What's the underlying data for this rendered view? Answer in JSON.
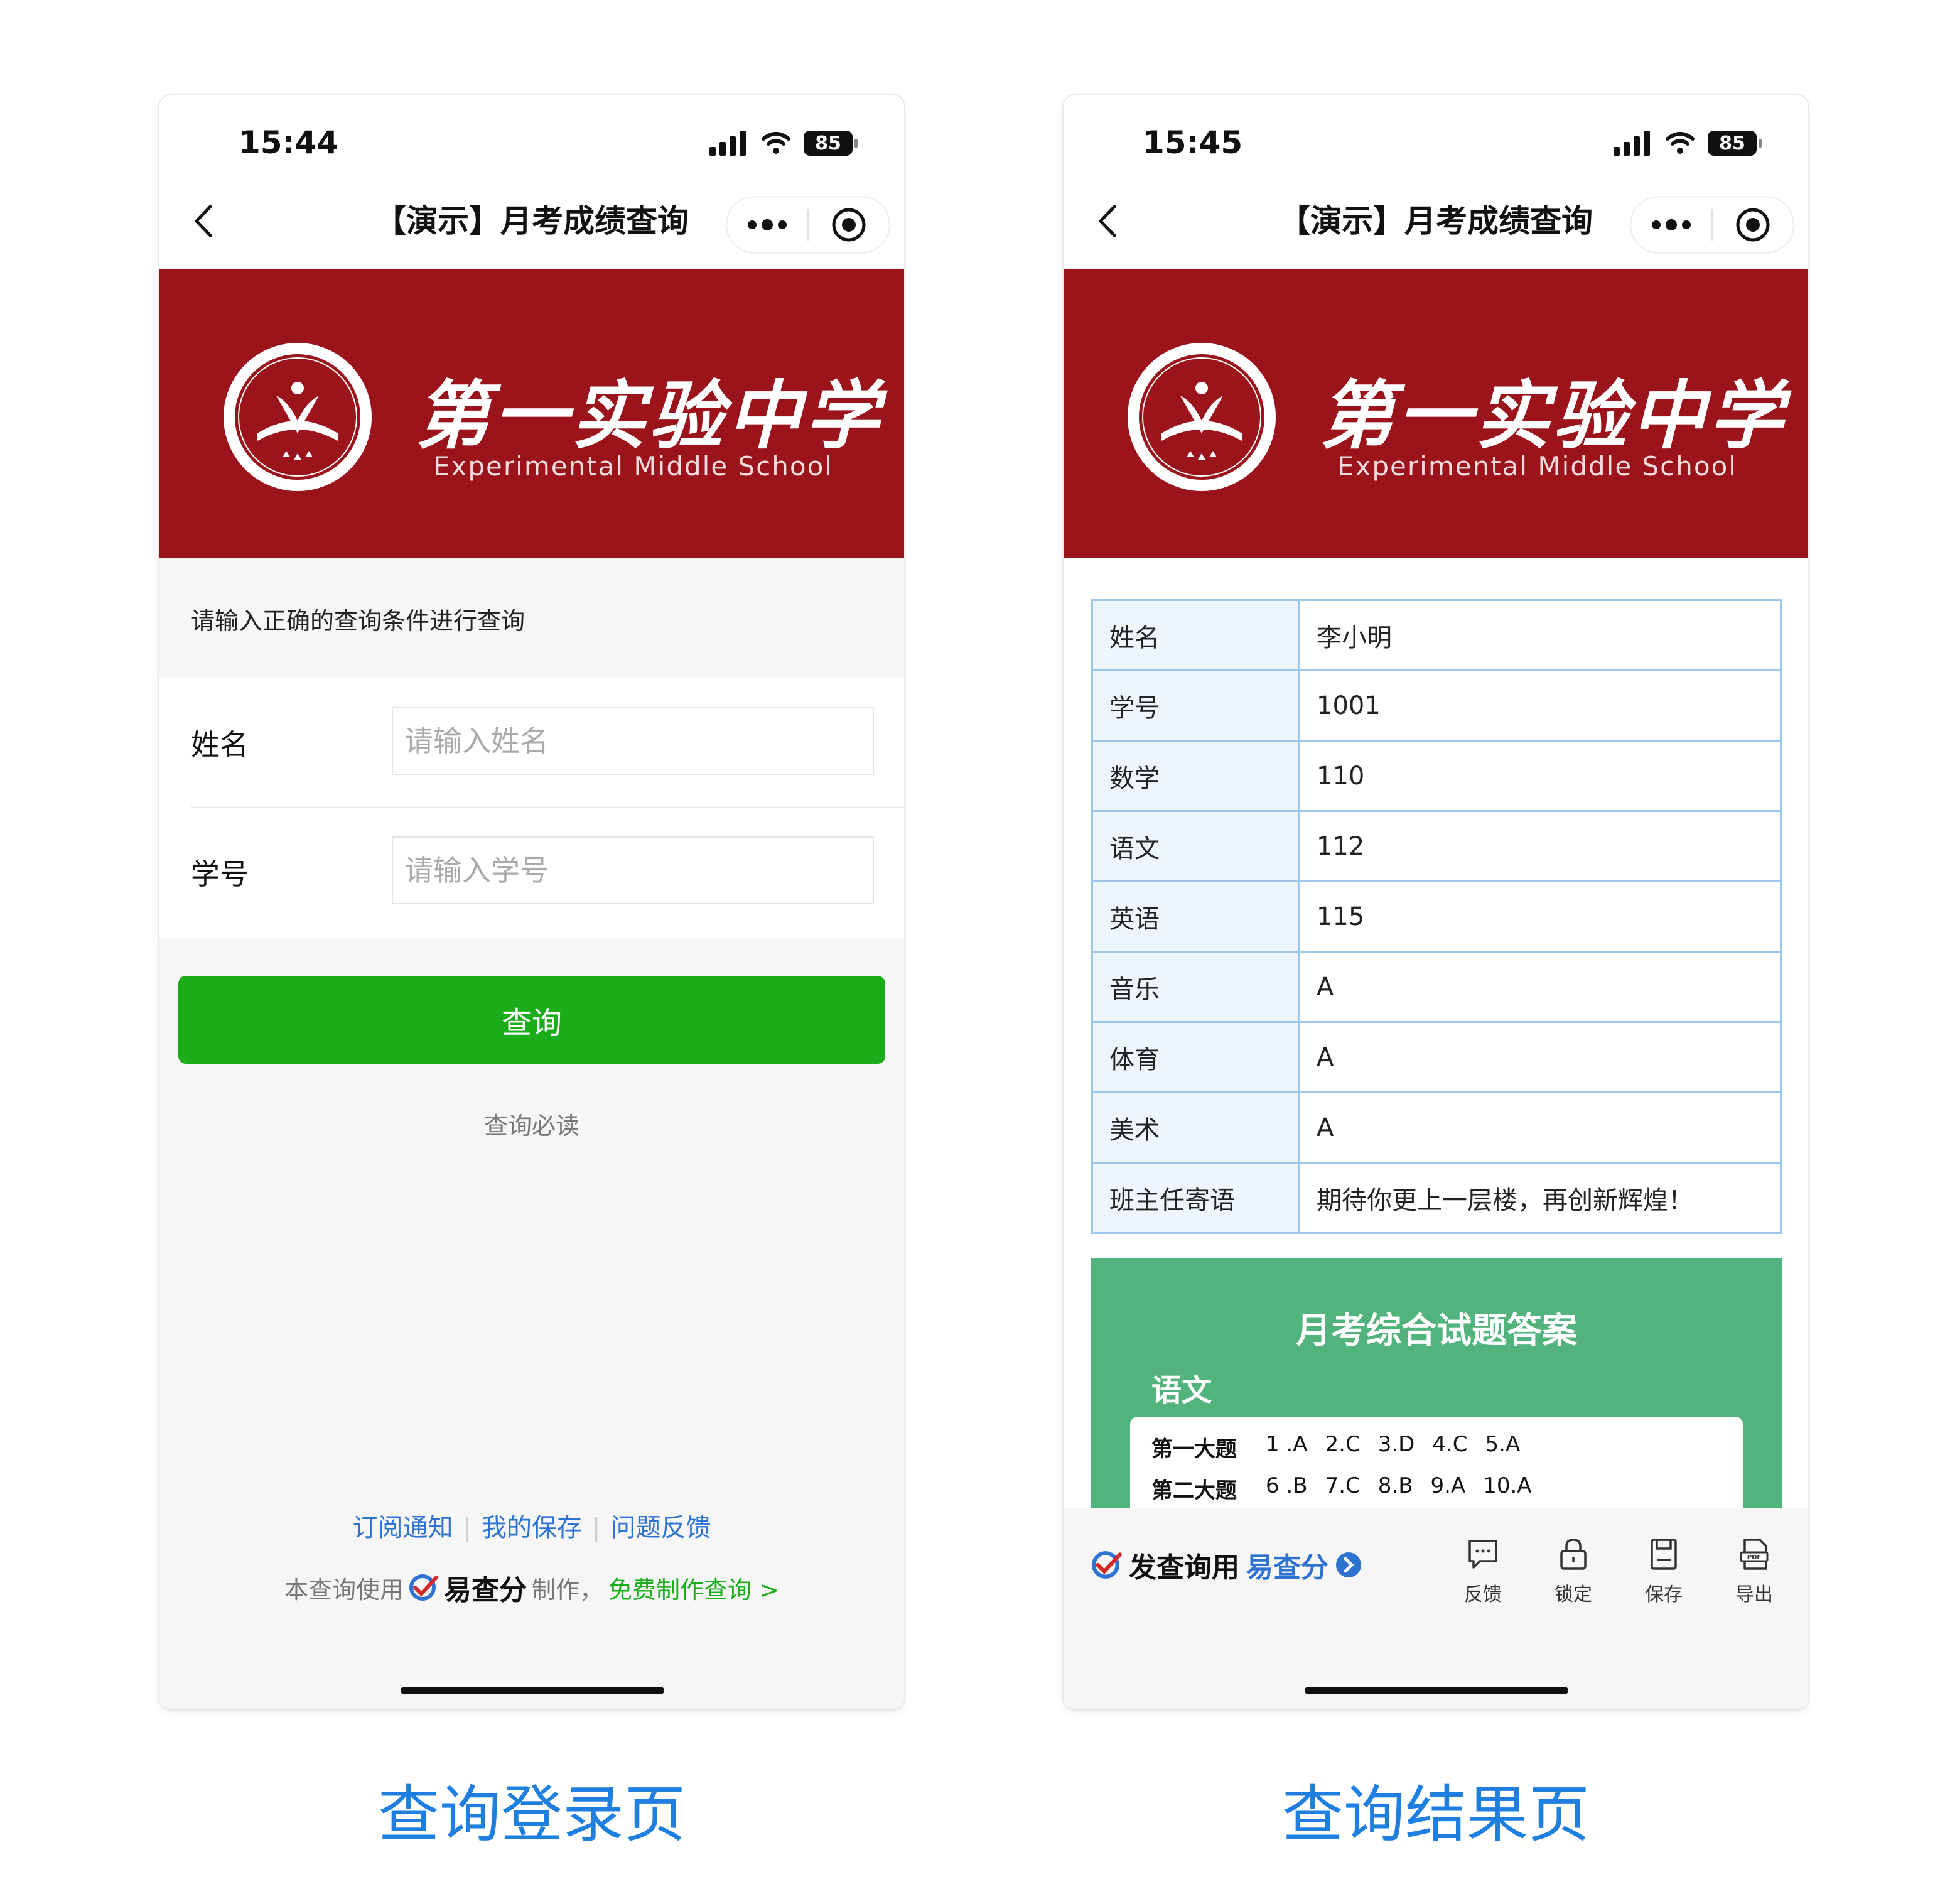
{
  "captions": {
    "left": "查询登录页",
    "right": "查询结果页"
  },
  "left": {
    "status": {
      "time": "15:44",
      "battery": "85"
    },
    "nav": {
      "title": "【演示】月考成绩查询"
    },
    "banner": {
      "school_cn": "第一实验中学",
      "school_en": "Experimental Middle School",
      "bg_color": "#9b141c"
    },
    "hint": "请输入正确的查询条件进行查询",
    "form": {
      "name_label": "姓名",
      "name_placeholder": "请输入姓名",
      "id_label": "学号",
      "id_placeholder": "请输入学号"
    },
    "query_button": "查询",
    "must_read": "查询必读",
    "footer": {
      "links": [
        "订阅通知",
        "我的保存",
        "问题反馈"
      ],
      "made_prefix": "本查询使用",
      "brand": "易查分",
      "made_suffix": "制作，",
      "free_link": "免费制作查询 >"
    }
  },
  "right": {
    "status": {
      "time": "15:45",
      "battery": "85"
    },
    "nav": {
      "title": "【演示】月考成绩查询"
    },
    "banner": {
      "school_cn": "第一实验中学",
      "school_en": "Experimental Middle School"
    },
    "results": [
      {
        "key": "姓名",
        "value": "李小明"
      },
      {
        "key": "学号",
        "value": "1001"
      },
      {
        "key": "数学",
        "value": "110"
      },
      {
        "key": "语文",
        "value": "112"
      },
      {
        "key": "英语",
        "value": "115"
      },
      {
        "key": "音乐",
        "value": "A"
      },
      {
        "key": "体育",
        "value": "A"
      },
      {
        "key": "美术",
        "value": "A"
      },
      {
        "key": "班主任寄语",
        "value": "期待你更上一层楼，再创新辉煌！"
      }
    ],
    "answers": {
      "title": "月考综合试题答案",
      "subject": "语文",
      "rows": [
        {
          "label": "第一大题",
          "items": [
            "1 .A",
            "2.C",
            "3.D",
            "4.C",
            "5.A"
          ]
        },
        {
          "label": "第二大题",
          "items": [
            "6 .B",
            "7.C",
            "8.B",
            "9.A",
            "10.A"
          ]
        }
      ]
    },
    "bottom": {
      "publish_prefix": "发查询用",
      "publish_brand": "易查分",
      "tools": [
        "反馈",
        "锁定",
        "保存",
        "导出"
      ]
    }
  },
  "colors": {
    "accent_green": "#1aad19",
    "link_blue": "#2e72d2",
    "answer_green": "#53b37c",
    "table_border": "#9cc6ee"
  }
}
